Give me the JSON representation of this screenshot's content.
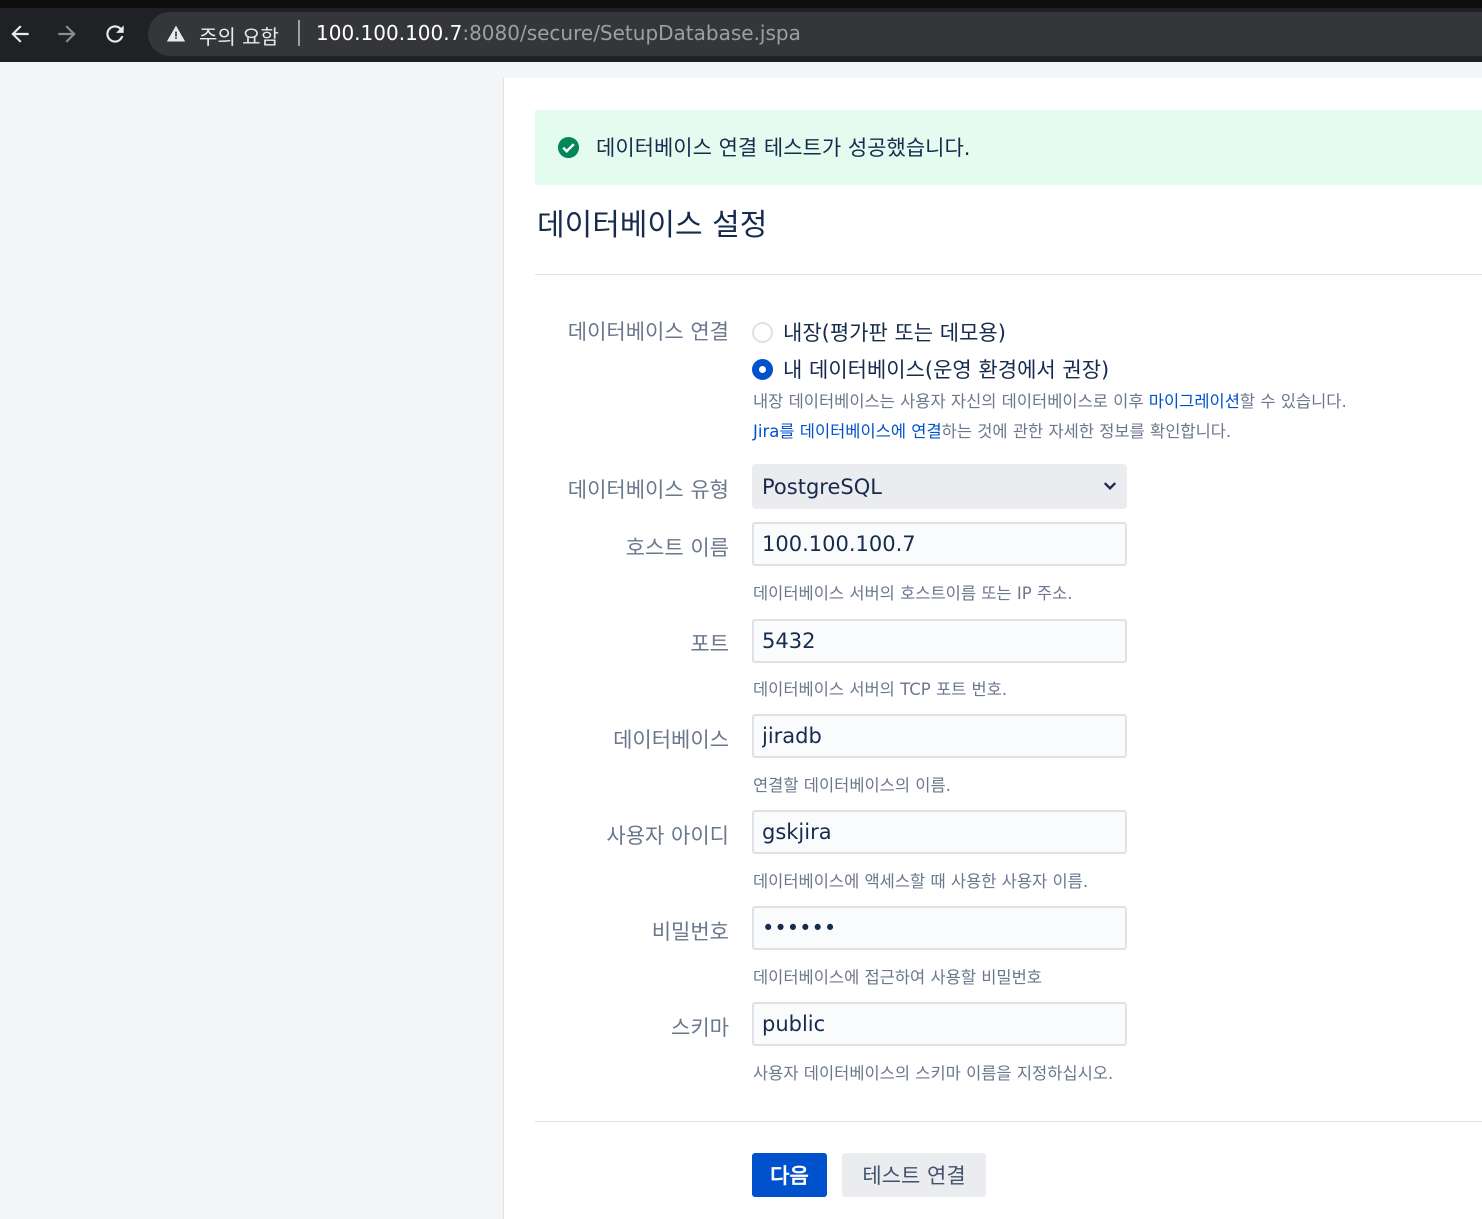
{
  "browser": {
    "security_warning": "주의 요함",
    "url_host": "100.100.100.7",
    "url_rest": ":8080/secure/SetupDatabase.jspa"
  },
  "alert": {
    "message": "데이터베이스 연결 테스트가 성공했습니다.",
    "icon": "check-circle-icon",
    "color": "#00875a"
  },
  "page": {
    "title": "데이터베이스 설정"
  },
  "form": {
    "connection": {
      "label": "데이터베이스 연결",
      "options": [
        {
          "label": "내장(평가판 또는 데모용)",
          "checked": false
        },
        {
          "label": "내 데이터베이스(운영 환경에서 권장)",
          "checked": true
        }
      ],
      "help_line1_prefix": "내장 데이터베이스는 사용자 자신의 데이터베이스로 이후 ",
      "help_line1_link": "마이그레이션",
      "help_line1_suffix": "할 수 있습니다.",
      "help_line2_link": "Jira를 데이터베이스에 연결",
      "help_line2_suffix": "하는 것에 관한 자세한 정보를 확인합니다."
    },
    "db_type": {
      "label": "데이터베이스 유형",
      "value": "PostgreSQL"
    },
    "hostname": {
      "label": "호스트 이름",
      "value": "100.100.100.7",
      "help": "데이터베이스 서버의 호스트이름 또는 IP 주소."
    },
    "port": {
      "label": "포트",
      "value": "5432",
      "help": "데이터베이스 서버의 TCP 포트 번호."
    },
    "database": {
      "label": "데이터베이스",
      "value": "jiradb",
      "help": "연결할 데이터베이스의 이름."
    },
    "username": {
      "label": "사용자 아이디",
      "value": "gskjira",
      "help": "데이터베이스에 액세스할 때 사용한 사용자 이름."
    },
    "password": {
      "label": "비밀번호",
      "value": "••••••",
      "help": "데이터베이스에 접근하여 사용할 비밀번호"
    },
    "schema": {
      "label": "스키마",
      "value": "public",
      "help": "사용자 데이터베이스의 스키마 이름을 지정하십시오."
    }
  },
  "buttons": {
    "next": "다음",
    "test_connection": "테스트 연결"
  },
  "colors": {
    "primary": "#0052cc",
    "success_bg": "#e3fcef",
    "text": "#172b4d",
    "muted": "#6b778c"
  }
}
